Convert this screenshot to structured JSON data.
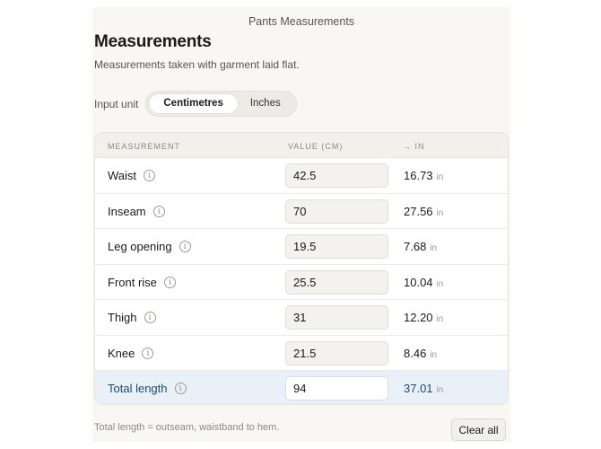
{
  "window": {
    "title": "Pants Measurements"
  },
  "header": {
    "title": "Measurements",
    "subtitle": "Measurements taken with garment laid flat."
  },
  "unit_toggle": {
    "label": "Input unit",
    "options": [
      "Centimetres",
      "Inches"
    ],
    "selected": "Centimetres"
  },
  "table": {
    "columns": [
      "MEASUREMENT",
      "VALUE (CM)",
      "→ IN"
    ],
    "unit_suffix": "in",
    "rows": [
      {
        "name": "Waist",
        "value": "42.5",
        "inches": "16.73"
      },
      {
        "name": "Inseam",
        "value": "70",
        "inches": "27.56"
      },
      {
        "name": "Leg opening",
        "value": "19.5",
        "inches": "7.68"
      },
      {
        "name": "Front rise",
        "value": "25.5",
        "inches": "10.04"
      },
      {
        "name": "Thigh",
        "value": "31",
        "inches": "12.20"
      },
      {
        "name": "Knee",
        "value": "21.5",
        "inches": "8.46"
      },
      {
        "name": "Total length",
        "value": "94",
        "inches": "37.01"
      }
    ]
  },
  "footer": {
    "note": "Total length = outseam, waistband to hem.",
    "clear_label": "Clear all"
  },
  "icons": {
    "info": "info-icon"
  },
  "colors": {
    "accent_total_row": "#e9f0f8",
    "accent_total_text": "#1d4b6e"
  }
}
